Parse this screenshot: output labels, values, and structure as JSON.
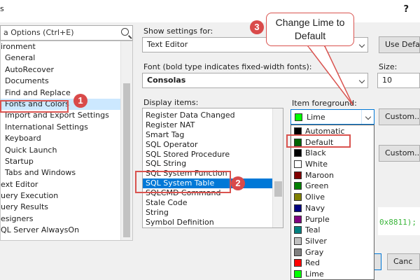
{
  "window": {
    "title": "s",
    "help": "?"
  },
  "search": {
    "placeholder": "a Options (Ctrl+E)"
  },
  "tree": {
    "items": [
      {
        "label": "ironment",
        "indent": 0
      },
      {
        "label": "General",
        "indent": 1
      },
      {
        "label": "AutoRecover",
        "indent": 1
      },
      {
        "label": "Documents",
        "indent": 1
      },
      {
        "label": "Find and Replace",
        "indent": 1
      },
      {
        "label": "Fonts and Colors",
        "indent": 1,
        "selected": true
      },
      {
        "label": "Import and Export Settings",
        "indent": 1
      },
      {
        "label": "International Settings",
        "indent": 1
      },
      {
        "label": "Keyboard",
        "indent": 1
      },
      {
        "label": "Quick Launch",
        "indent": 1
      },
      {
        "label": "Startup",
        "indent": 1
      },
      {
        "label": "Tabs and Windows",
        "indent": 1
      },
      {
        "label": "ext Editor",
        "indent": 0
      },
      {
        "label": "uery Execution",
        "indent": 0
      },
      {
        "label": "uery Results",
        "indent": 0
      },
      {
        "label": "esigners",
        "indent": 0
      },
      {
        "label": "QL Server AlwaysOn",
        "indent": 0
      }
    ]
  },
  "settings": {
    "show_settings_label": "Show settings for:",
    "show_settings_value": "Text Editor",
    "use_default_button": "Use Defau",
    "font_label": "Font (bold type indicates fixed-width fonts):",
    "font_value": "Consolas",
    "size_label": "Size:",
    "size_value": "10"
  },
  "display_items": {
    "label": "Display items:",
    "items": [
      {
        "label": "Register Data Changed"
      },
      {
        "label": "Register NAT"
      },
      {
        "label": "Smart Tag"
      },
      {
        "label": "SQL Operator"
      },
      {
        "label": "SQL Stored Procedure"
      },
      {
        "label": "SQL String"
      },
      {
        "label": "SQL System Function"
      },
      {
        "label": "SQL System Table",
        "selected": true
      },
      {
        "label": "SQLCMD Command"
      },
      {
        "label": "Stale Code"
      },
      {
        "label": "String"
      },
      {
        "label": "Symbol Definition"
      }
    ]
  },
  "foreground": {
    "label": "Item foreground:",
    "selected": "Lime",
    "selected_color": "#00ff00",
    "custom_button": "Custom...",
    "options": [
      {
        "label": "Automatic",
        "color": "#000000"
      },
      {
        "label": "Default",
        "color": "#006400"
      },
      {
        "label": "Black",
        "color": "#000000"
      },
      {
        "label": "White",
        "color": "#ffffff"
      },
      {
        "label": "Maroon",
        "color": "#800000"
      },
      {
        "label": "Green",
        "color": "#008000"
      },
      {
        "label": "Olive",
        "color": "#808000"
      },
      {
        "label": "Navy",
        "color": "#000080"
      },
      {
        "label": "Purple",
        "color": "#800080"
      },
      {
        "label": "Teal",
        "color": "#008080"
      },
      {
        "label": "Silver",
        "color": "#c0c0c0"
      },
      {
        "label": "Gray",
        "color": "#808080"
      },
      {
        "label": "Red",
        "color": "#ff0000"
      },
      {
        "label": "Lime",
        "color": "#00ff00"
      }
    ]
  },
  "background": {
    "custom_button": "Custom..."
  },
  "preview": {
    "code": "0x8811);"
  },
  "bottom": {
    "cancel_button": "Canc"
  },
  "annotations": {
    "callout": "Change Lime to Default",
    "badge1": "1",
    "badge2": "2",
    "badge3": "3"
  }
}
